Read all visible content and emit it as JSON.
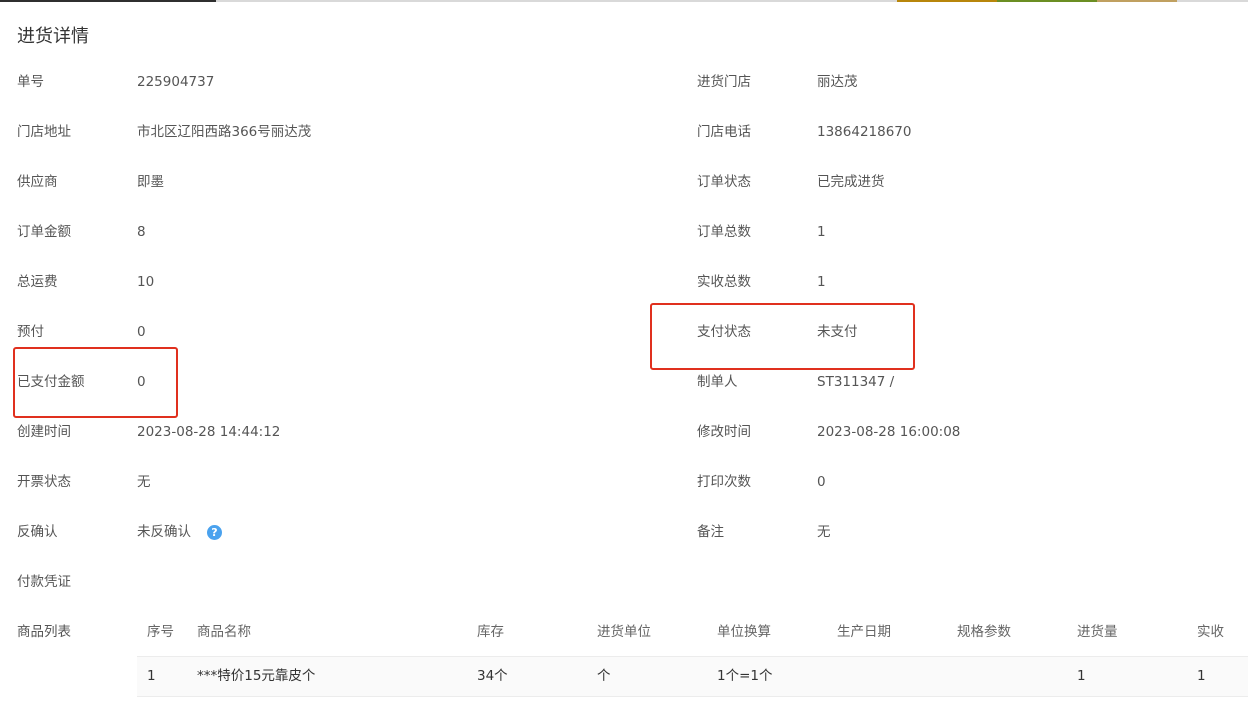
{
  "page": {
    "title": "进货详情"
  },
  "fields_left": [
    {
      "label": "单号",
      "value": "225904737"
    },
    {
      "label": "门店地址",
      "value": "市北区辽阳西路366号丽达茂"
    },
    {
      "label": "供应商",
      "value": "即墨"
    },
    {
      "label": "订单金额",
      "value": "8"
    },
    {
      "label": "总运费",
      "value": "10"
    },
    {
      "label": "预付",
      "value": "0"
    },
    {
      "label": "已支付金额",
      "value": "0"
    },
    {
      "label": "创建时间",
      "value": "2023-08-28 14:44:12"
    },
    {
      "label": "开票状态",
      "value": "无"
    },
    {
      "label": "反确认",
      "value": "未反确认"
    },
    {
      "label": "付款凭证",
      "value": ""
    },
    {
      "label": "商品列表",
      "value": ""
    }
  ],
  "fields_right": [
    {
      "label": "进货门店",
      "value": "丽达茂"
    },
    {
      "label": "门店电话",
      "value": "13864218670"
    },
    {
      "label": "订单状态",
      "value": "已完成进货"
    },
    {
      "label": "订单总数",
      "value": "1"
    },
    {
      "label": "实收总数",
      "value": "1"
    },
    {
      "label": "支付状态",
      "value": "未支付"
    },
    {
      "label": "制单人",
      "value": "ST311347 /"
    },
    {
      "label": "修改时间",
      "value": "2023-08-28 16:00:08"
    },
    {
      "label": "打印次数",
      "value": "0"
    },
    {
      "label": "备注",
      "value": "无"
    }
  ],
  "help_icon_glyph": "?",
  "goods_table": {
    "headers": [
      "序号",
      "商品名称",
      "库存",
      "进货单位",
      "单位换算",
      "生产日期",
      "规格参数",
      "进货量",
      "实收"
    ],
    "rows": [
      [
        "1",
        "***特价15元靠皮个",
        "34个",
        "个",
        "1个=1个",
        "",
        "",
        "1",
        "1"
      ]
    ]
  },
  "colors": {
    "highlight": "#e0301e",
    "help_icon": "#4aa2ee"
  }
}
